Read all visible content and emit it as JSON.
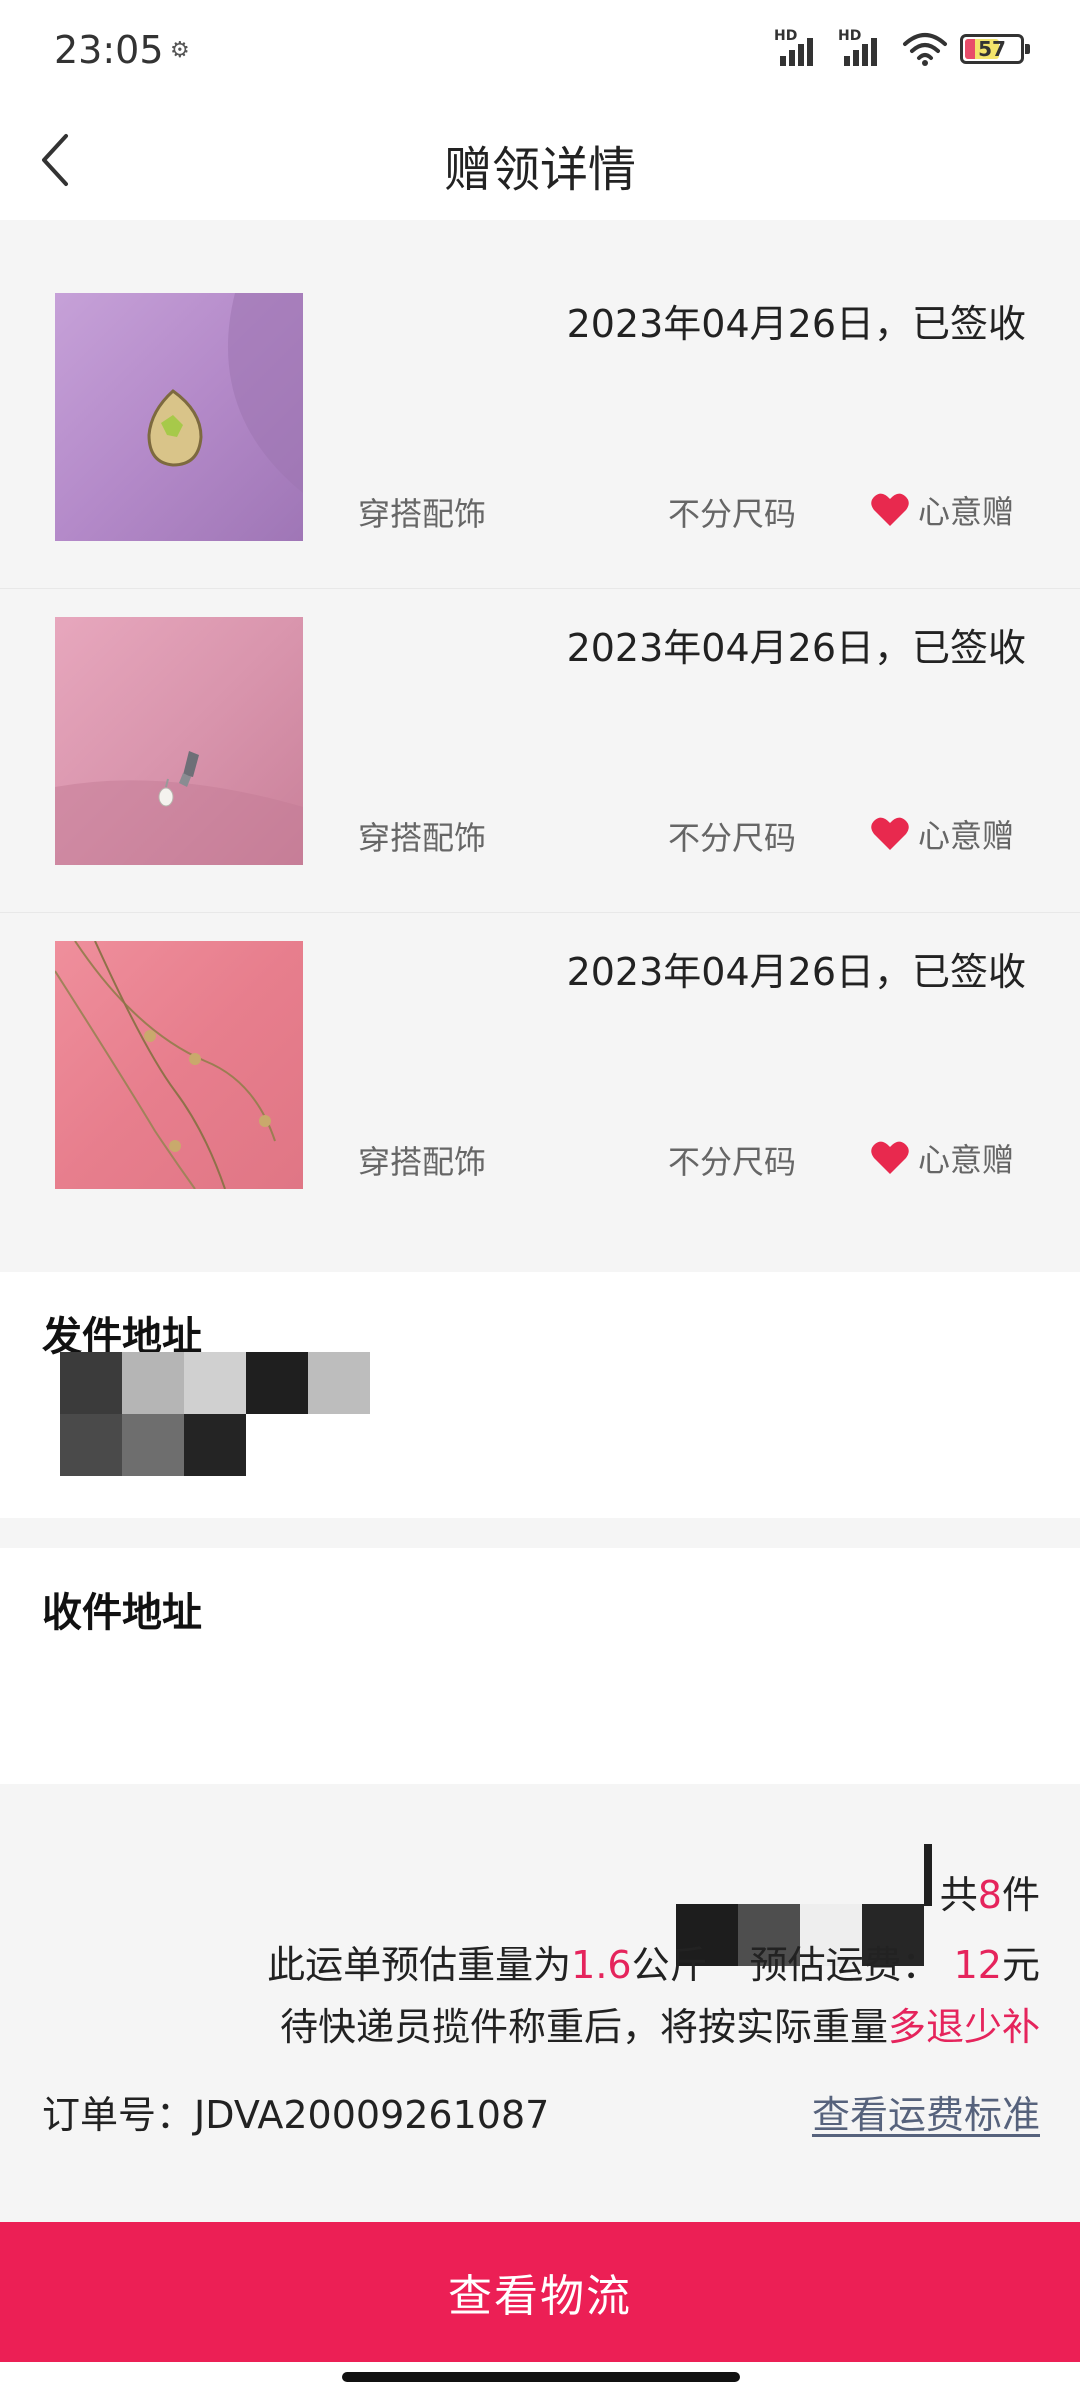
{
  "status_bar": {
    "time": "23:05",
    "battery": "57",
    "network_label": "HD"
  },
  "nav": {
    "title": "赠领详情"
  },
  "items": [
    {
      "date_status": "2023年04月26日，已签收",
      "category": "穿搭配饰",
      "size": "不分尺码",
      "tag": "心意赠"
    },
    {
      "date_status": "2023年04月26日，已签收",
      "category": "穿搭配饰",
      "size": "不分尺码",
      "tag": "心意赠"
    },
    {
      "date_status": "2023年04月26日，已签收",
      "category": "穿搭配饰",
      "size": "不分尺码",
      "tag": "心意赠"
    }
  ],
  "send_address": {
    "title": "发件地址"
  },
  "receive_address": {
    "title": "收件地址"
  },
  "summary": {
    "count_prefix": "共",
    "count_value": "8",
    "count_suffix": "件",
    "weight_prefix": "此运单预估重量为",
    "weight_value": "1.6",
    "weight_unit": "公斤",
    "fee_label": "预估运费：",
    "fee_value": "12",
    "fee_unit": "元",
    "note_prefix": "待快递员揽件称重后，将按实际重量",
    "note_accent": "多退少补",
    "order_label": "订单号：",
    "order_number": "JDVA20009261087",
    "fee_standard_link": "查看运费标准"
  },
  "button": {
    "logistics_label": "查看物流"
  },
  "colors": {
    "accent": "#e5245c",
    "button": "#ec1f55",
    "link": "#56627c",
    "heart": "#e8294e"
  },
  "icons": {
    "back": "chevron-left-icon",
    "heart": "heart-icon",
    "wifi": "wifi-icon",
    "signal": "signal-icon",
    "battery": "battery-icon",
    "settings": "gear-icon"
  }
}
